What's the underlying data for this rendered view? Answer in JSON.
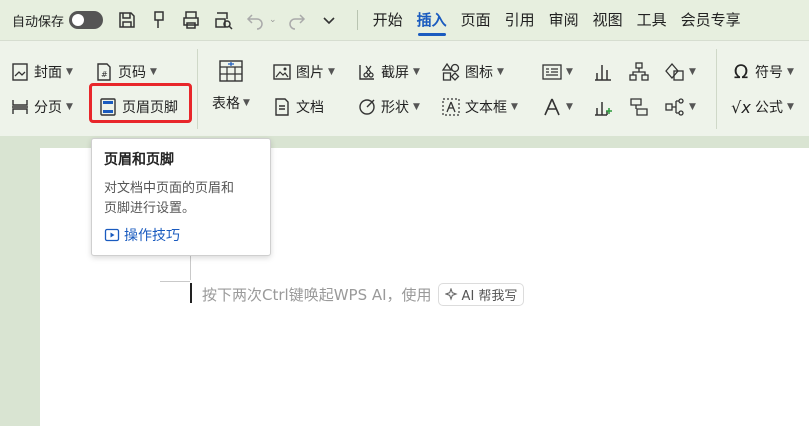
{
  "quick_access": {
    "autosave_label": "自动保存",
    "autosave_on": false
  },
  "menu_tabs": [
    {
      "label": "开始",
      "active": false
    },
    {
      "label": "插入",
      "active": true
    },
    {
      "label": "页面",
      "active": false
    },
    {
      "label": "引用",
      "active": false
    },
    {
      "label": "审阅",
      "active": false
    },
    {
      "label": "视图",
      "active": false
    },
    {
      "label": "工具",
      "active": false
    },
    {
      "label": "会员专享",
      "active": false
    }
  ],
  "ribbon": {
    "cover": "封面",
    "page_number": "页码",
    "page_break": "分页",
    "header_footer": "页眉页脚",
    "table": "表格",
    "picture": "图片",
    "document": "文档",
    "screenshot": "截屏",
    "shape": "形状",
    "icon": "图标",
    "textbox": "文本框",
    "symbol": "符号",
    "formula": "公式"
  },
  "tooltip": {
    "title": "页眉和页脚",
    "description_line1": "对文档中页面的页眉和",
    "description_line2": "页脚进行设置。",
    "link": "操作技巧"
  },
  "document": {
    "ai_hint": "按下两次Ctrl键唤起WPS AI，使用",
    "ai_button": "AI 帮我写"
  },
  "colors": {
    "accent": "#1a5bbf",
    "highlight": "#e8262a"
  }
}
